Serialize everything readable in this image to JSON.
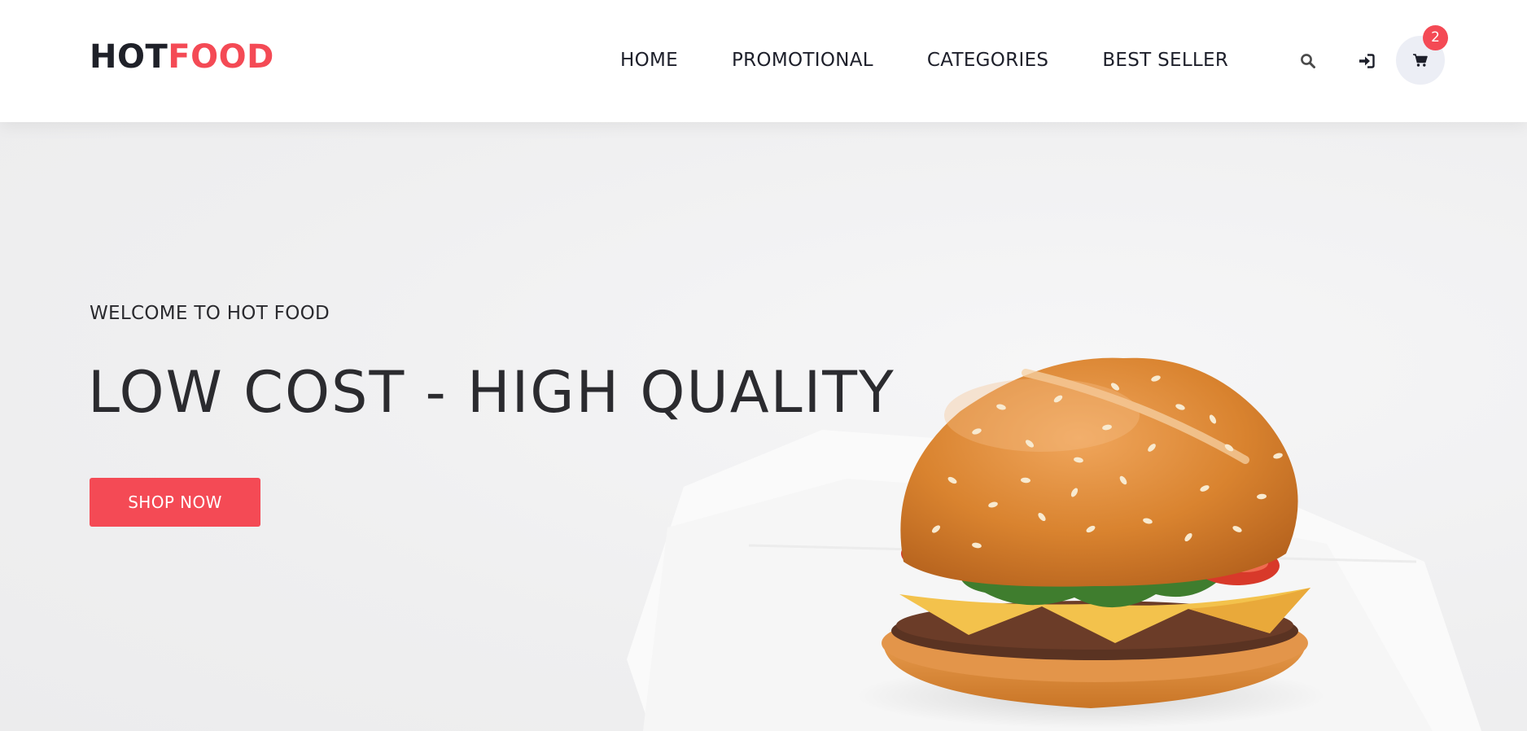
{
  "brand": {
    "part1": "HOT",
    "part2": "FOOD",
    "color_dark": "#1f2129",
    "color_accent": "#f44a55"
  },
  "nav": {
    "items": [
      {
        "label": "HOME"
      },
      {
        "label": "PROMOTIONAL"
      },
      {
        "label": "CATEGORIES"
      },
      {
        "label": "BEST SELLER"
      }
    ]
  },
  "actions": {
    "search_icon": "search-icon",
    "login_icon": "sign-in-icon",
    "cart_icon": "shopping-cart-icon",
    "cart_count": "2"
  },
  "hero": {
    "welcome": "WELCOME TO HOT FOOD",
    "headline": "LOW COST - HIGH QUALITY",
    "cta_label": "SHOP NOW",
    "cta_color": "#f44a55"
  }
}
